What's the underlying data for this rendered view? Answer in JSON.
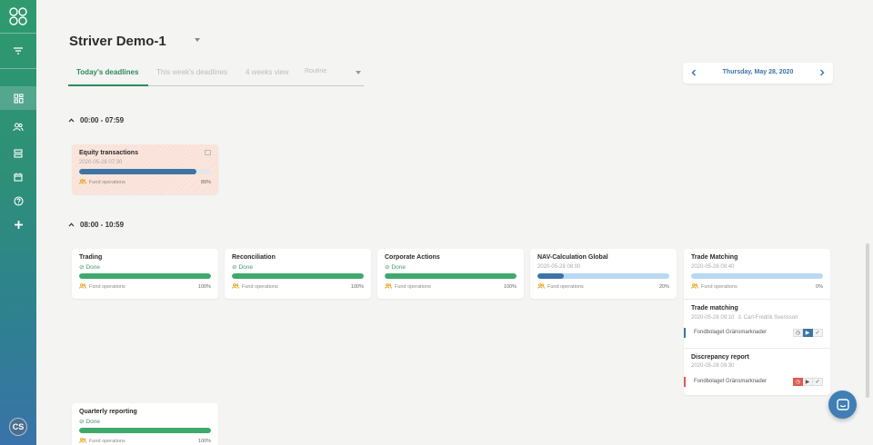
{
  "app": {
    "user_initials": "CS"
  },
  "header": {
    "title": "Striver Demo-1",
    "tabs": [
      {
        "label": "Today's deadlines",
        "active": true
      },
      {
        "label": "This week's deadlines",
        "active": false
      },
      {
        "label": "4 weeks view",
        "active": false
      },
      {
        "label": "Routine",
        "active": false
      }
    ],
    "date": "Thursday, May 28, 2020"
  },
  "sections": [
    {
      "label": "00:00 - 07:59",
      "cards": [
        {
          "title": "Equity transactions",
          "sub": "2020-05-28 07:30",
          "group": "Fund operations",
          "percent": "89%",
          "progress": 0.89,
          "color": "#3d74a6",
          "state": "warning"
        }
      ]
    },
    {
      "label": "08:00 - 10:59",
      "cards": [
        {
          "title": "Trading",
          "status": "Done",
          "group": "Fund operations",
          "percent": "100%",
          "progress": 1.0,
          "color": "#3fa96c"
        },
        {
          "title": "Reconciliation",
          "status": "Done",
          "group": "Fund operations",
          "percent": "100%",
          "progress": 1.0,
          "color": "#3fa96c"
        },
        {
          "title": "Corporate Actions",
          "status": "Done",
          "group": "Fund operations",
          "percent": "100%",
          "progress": 1.0,
          "color": "#3fa96c"
        },
        {
          "title": "NAV-Calculation Global",
          "sub": "2020-05-28 08:00",
          "group": "Fund operations",
          "percent": "20%",
          "progress": 0.2,
          "color": "#3d74a6",
          "rest": "#b9d9f2"
        },
        {
          "title": "Trade Matching",
          "sub": "2020-05-28 08:40",
          "group": "Fund operations",
          "percent": "0%",
          "progress": 0.0,
          "color": "#b9d9f2",
          "rest": "#b9d9f2"
        },
        {
          "title": "Quarterly reporting",
          "status": "Done",
          "group": "Fund operations",
          "percent": "100%",
          "progress": 1.0,
          "color": "#3fa96c"
        }
      ],
      "subtasks": [
        {
          "title": "Trade matching",
          "meta": "2020-05-28 09:10",
          "assignee": "Carl-Fredrik Svensson",
          "fund": "Fondbolaget Gränsmarknader",
          "accent": "#3d74a6"
        },
        {
          "title": "Discrepancy report",
          "meta": "2020-05-28 09:30",
          "fund": "Fondbolaget Gränsmarknader",
          "accent": "#e05a4f"
        }
      ]
    }
  ],
  "colors": {
    "brand": "#2f8a5e",
    "accent_blue": "#3a74a8",
    "done_green": "#3fa96c",
    "warn_bg": "#fbe7df"
  }
}
